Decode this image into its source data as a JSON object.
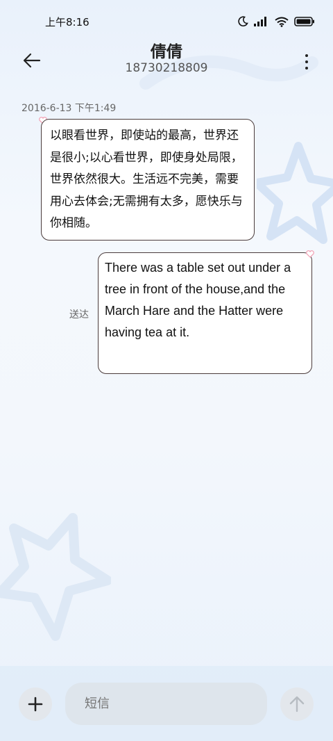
{
  "status_bar": {
    "time": "上午8:16",
    "icons": [
      "moon-icon",
      "signal-icon",
      "wifi-icon",
      "battery-icon"
    ]
  },
  "header": {
    "contact_name": "倩倩",
    "contact_number": "18730218809",
    "back_icon": "arrow-left-icon",
    "more_icon": "more-vertical-icon"
  },
  "conversation": {
    "timestamp": "2016-6-13 下午1:49",
    "messages": [
      {
        "direction": "incoming",
        "text": "以眼看世界，即使站的最高，世界还是很小;以心看世界，即使身处局限，世界依然很大。生活远不完美，需要用心去体会;无需拥有太多，愿快乐与你相随。"
      },
      {
        "direction": "outgoing",
        "status": "送达",
        "text": "There was a table set out under a tree in front of the house,and the March Hare and the Hatter were having tea at it."
      }
    ]
  },
  "composer": {
    "placeholder": "短信",
    "add_icon": "plus-icon",
    "send_icon": "arrow-up-icon"
  },
  "colors": {
    "bubble_border": "#4a3b3b",
    "heart": "#f2a0b4",
    "background": "#eef4fb"
  }
}
